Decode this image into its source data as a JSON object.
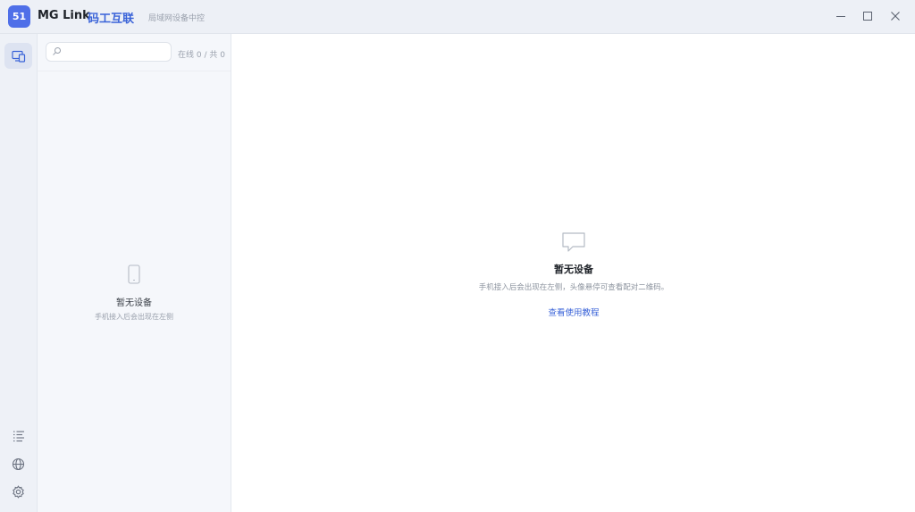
{
  "app": {
    "logo_text": "51",
    "name": "MG Link",
    "name_cn": "码工互联",
    "subtitle": "局域网设备中控"
  },
  "window_controls": {
    "minimize_icon": "minimize-icon",
    "maximize_icon": "maximize-icon",
    "close_icon": "close-icon"
  },
  "rail": {
    "items": [
      {
        "icon": "devices-icon",
        "active": true
      },
      {
        "icon": "list-icon",
        "active": false
      },
      {
        "icon": "globe-icon",
        "active": false
      },
      {
        "icon": "gear-icon",
        "active": false
      }
    ]
  },
  "device_panel": {
    "search": {
      "placeholder": "",
      "value": ""
    },
    "count_text": "在线 0 / 共 0",
    "empty": {
      "icon": "phone-icon",
      "title": "暂无设备",
      "desc": "手机接入后会出现在左侧"
    }
  },
  "main": {
    "empty": {
      "icon": "chat-bubble-icon",
      "title": "暂无设备",
      "desc": "手机接入后会出现在左侧，头像悬停可查看配对二维码。",
      "link": "查看使用教程"
    }
  },
  "colors": {
    "accent": "#3a63d8",
    "logo_bg": "#4f6fe8",
    "titlebar_bg": "#edf0f6",
    "panel_bg": "#f5f7fb"
  }
}
